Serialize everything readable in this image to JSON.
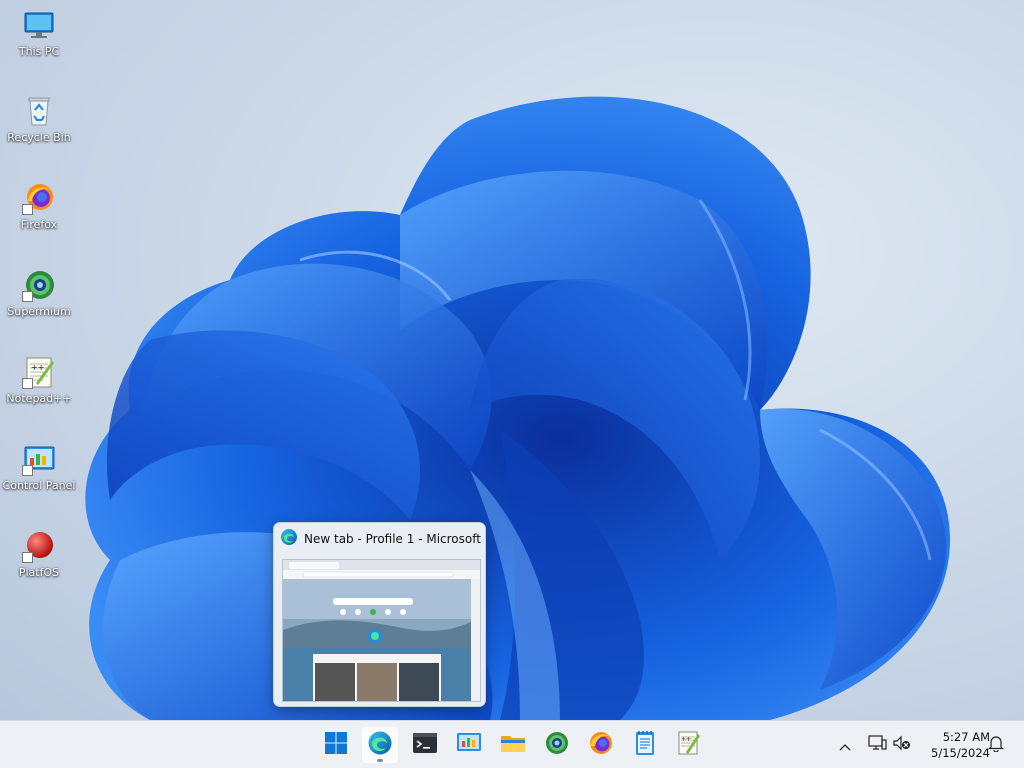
{
  "desktop": {
    "icons": [
      {
        "label": "This PC",
        "icon": "computer-icon"
      },
      {
        "label": "Recycle Bin",
        "icon": "recycle-bin-icon"
      },
      {
        "label": "Firefox",
        "icon": "firefox-icon"
      },
      {
        "label": "Supermium",
        "icon": "supermium-icon"
      },
      {
        "label": "Notepad++",
        "icon": "notepad-plus-plus-icon"
      },
      {
        "label": "Control Panel",
        "icon": "control-panel-icon"
      },
      {
        "label": "PlatfOS",
        "icon": "platfos-icon"
      }
    ]
  },
  "preview": {
    "title": "New tab - Profile 1 - Microsoft ...",
    "icon": "edge-icon"
  },
  "taskbar": {
    "apps": [
      {
        "name": "Start",
        "icon": "windows-start-icon"
      },
      {
        "name": "Microsoft Edge",
        "icon": "edge-icon",
        "active": true
      },
      {
        "name": "Terminal",
        "icon": "terminal-icon"
      },
      {
        "name": "Control Panel",
        "icon": "control-panel-icon"
      },
      {
        "name": "File Explorer",
        "icon": "folder-icon"
      },
      {
        "name": "Supermium",
        "icon": "supermium-icon"
      },
      {
        "name": "Firefox",
        "icon": "firefox-icon"
      },
      {
        "name": "Notepad",
        "icon": "notepad-icon"
      },
      {
        "name": "Notepad++",
        "icon": "notepad-plus-plus-icon"
      }
    ],
    "tray": {
      "time": "5:27 AM",
      "date": "5/15/2024"
    }
  },
  "colors": {
    "accent": "#0067c0",
    "wallpaper_blue": "#1a5fd8"
  }
}
